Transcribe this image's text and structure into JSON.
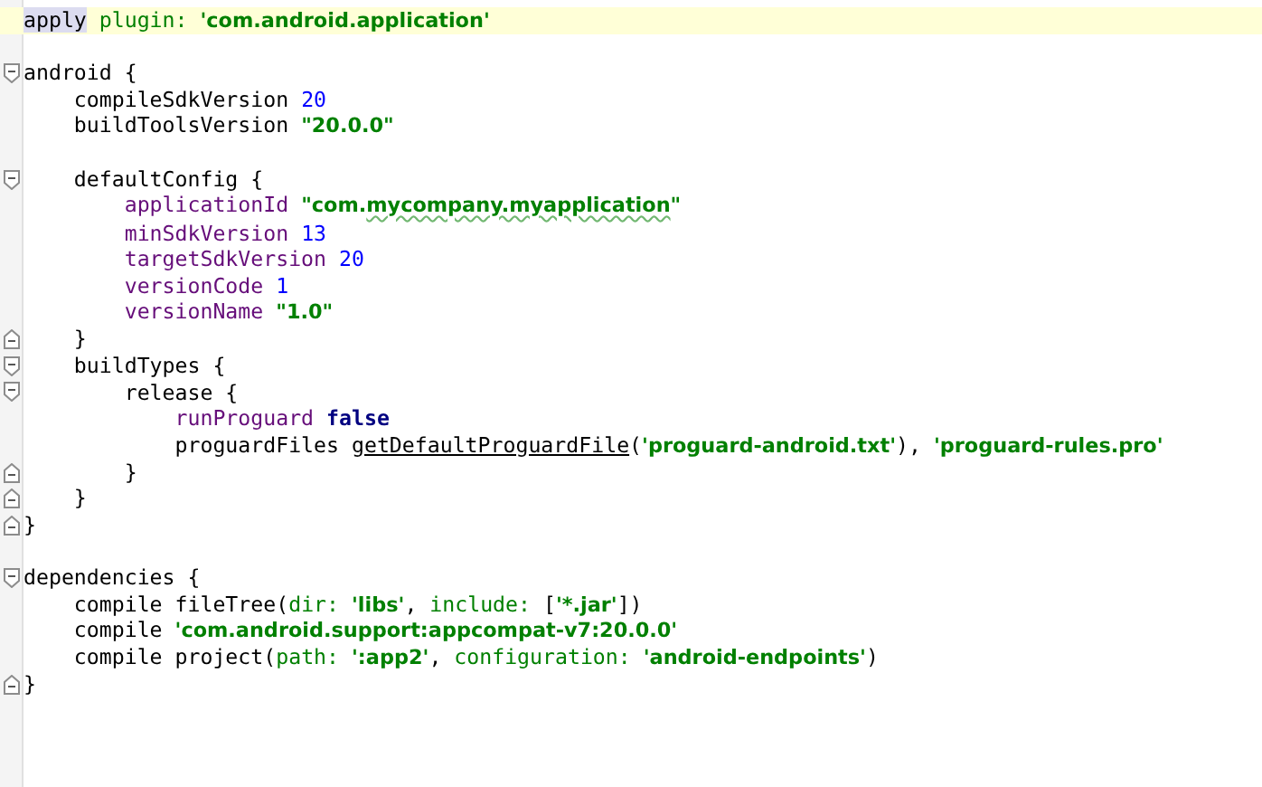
{
  "editor": {
    "lines": [
      {
        "current": true,
        "tokens": [
          {
            "kind": "highlighted-word",
            "text": "apply"
          },
          {
            "kind": "label",
            "text": " plugin: "
          },
          {
            "kind": "string",
            "text": "'com.android.application'"
          }
        ]
      },
      {
        "current": false
      },
      {
        "current": false,
        "kind": "block-start",
        "tokens": [
          {
            "kind": "plain",
            "text": "android {"
          }
        ]
      },
      {
        "current": false,
        "tokens": [
          {
            "kind": "plain",
            "text": "    compileSdkVersion "
          },
          {
            "kind": "number",
            "text": "20"
          }
        ]
      },
      {
        "current": false,
        "tokens": [
          {
            "kind": "plain",
            "text": "    buildToolsVersion "
          },
          {
            "kind": "string",
            "text": "\"20.0.0\""
          }
        ]
      },
      {
        "current": false
      },
      {
        "current": false,
        "kind": "block-start",
        "tokens": [
          {
            "kind": "plain",
            "text": "    defaultConfig {"
          }
        ]
      },
      {
        "current": false,
        "tokens": [
          {
            "kind": "keyword",
            "text": "        applicationId "
          },
          {
            "kind": "string",
            "text": "\"com."
          },
          {
            "kind": "string-typo",
            "text": "mycompany.myapplication"
          },
          {
            "kind": "string",
            "text": "\""
          }
        ]
      },
      {
        "current": false,
        "tokens": [
          {
            "kind": "keyword",
            "text": "        minSdkVersion "
          },
          {
            "kind": "number",
            "text": "13"
          }
        ]
      },
      {
        "current": false,
        "tokens": [
          {
            "kind": "keyword",
            "text": "        targetSdkVersion "
          },
          {
            "kind": "number",
            "text": "20"
          }
        ]
      },
      {
        "current": false,
        "tokens": [
          {
            "kind": "keyword",
            "text": "        versionCode "
          },
          {
            "kind": "number",
            "text": "1"
          }
        ]
      },
      {
        "current": false,
        "tokens": [
          {
            "kind": "keyword",
            "text": "        versionName "
          },
          {
            "kind": "string",
            "text": "\"1.0\""
          }
        ]
      },
      {
        "current": false,
        "kind": "block-end",
        "tokens": [
          {
            "kind": "plain",
            "text": "    }"
          }
        ]
      },
      {
        "current": false,
        "kind": "block-start",
        "tokens": [
          {
            "kind": "plain",
            "text": "    buildTypes {"
          }
        ]
      },
      {
        "current": false,
        "kind": "block-start",
        "tokens": [
          {
            "kind": "plain",
            "text": "        release {"
          }
        ]
      },
      {
        "current": false,
        "tokens": [
          {
            "kind": "keyword",
            "text": "            runProguard "
          },
          {
            "kind": "constant",
            "text": "false"
          }
        ]
      },
      {
        "current": false,
        "tokens": [
          {
            "kind": "plain",
            "text": "            proguardFiles "
          },
          {
            "kind": "method",
            "text": "getDefaultProguardFile"
          },
          {
            "kind": "plain",
            "text": "("
          },
          {
            "kind": "string",
            "text": "'proguard-android.txt'"
          },
          {
            "kind": "plain",
            "text": "), "
          },
          {
            "kind": "string",
            "text": "'proguard-rules.pro'"
          }
        ]
      },
      {
        "current": false,
        "kind": "block-end",
        "tokens": [
          {
            "kind": "plain",
            "text": "        }"
          }
        ]
      },
      {
        "current": false,
        "kind": "block-end",
        "tokens": [
          {
            "kind": "plain",
            "text": "    }"
          }
        ]
      },
      {
        "current": false,
        "kind": "block-end",
        "tokens": [
          {
            "kind": "plain",
            "text": "}"
          }
        ]
      },
      {
        "current": false
      },
      {
        "current": false,
        "kind": "block-start",
        "tokens": [
          {
            "kind": "plain",
            "text": "dependencies {"
          }
        ]
      },
      {
        "current": false,
        "tokens": [
          {
            "kind": "plain",
            "text": "    compile fileTree("
          },
          {
            "kind": "label",
            "text": "dir: "
          },
          {
            "kind": "string",
            "text": "'libs'"
          },
          {
            "kind": "plain",
            "text": ", "
          },
          {
            "kind": "label",
            "text": "include: "
          },
          {
            "kind": "plain",
            "text": "["
          },
          {
            "kind": "string",
            "text": "'*.jar'"
          },
          {
            "kind": "plain",
            "text": "])"
          }
        ]
      },
      {
        "current": false,
        "tokens": [
          {
            "kind": "plain",
            "text": "    compile "
          },
          {
            "kind": "string",
            "text": "'com.android.support:appcompat-v7:20.0.0'"
          }
        ]
      },
      {
        "current": false,
        "tokens": [
          {
            "kind": "plain",
            "text": "    compile project("
          },
          {
            "kind": "label",
            "text": "path: "
          },
          {
            "kind": "string",
            "text": "':app2'"
          },
          {
            "kind": "plain",
            "text": ", "
          },
          {
            "kind": "label",
            "text": "configuration: "
          },
          {
            "kind": "string",
            "text": "'android-endpoints'"
          },
          {
            "kind": "plain",
            "text": ")"
          }
        ]
      },
      {
        "current": false,
        "kind": "block-end",
        "tokens": [
          {
            "kind": "plain",
            "text": "}"
          }
        ]
      }
    ]
  }
}
